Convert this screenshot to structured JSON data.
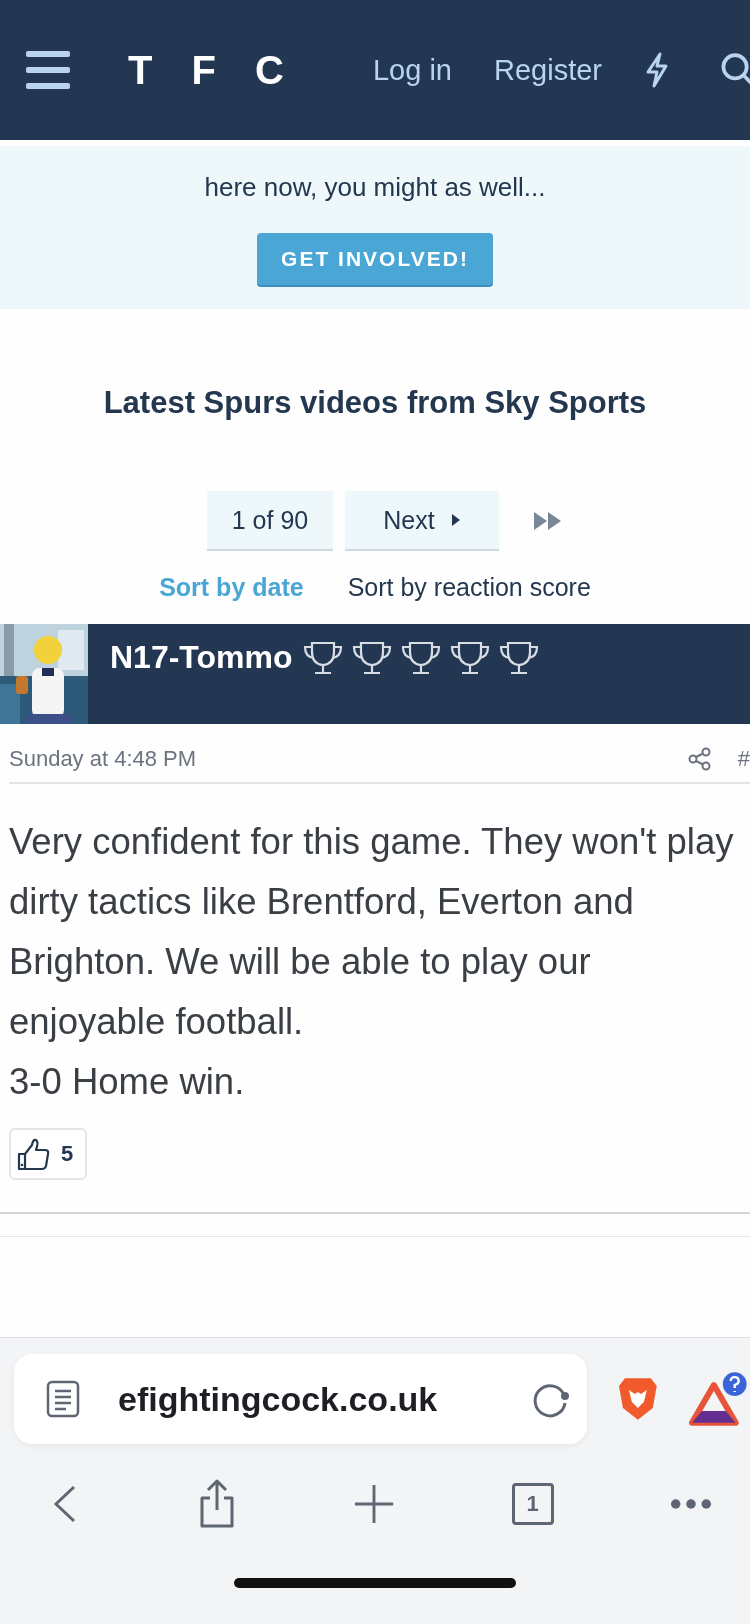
{
  "header": {
    "logo": "T F C",
    "nav": [
      {
        "label": "Log in"
      },
      {
        "label": "Register"
      }
    ]
  },
  "banner": {
    "text": "here now, you might as well...",
    "button": "GET INVOLVED!"
  },
  "section_title": "Latest Spurs videos from Sky Sports",
  "pagination": {
    "page": "1 of 90",
    "next": "Next"
  },
  "sort_options": [
    {
      "label": "Sort by date",
      "selected": true
    },
    {
      "label": "Sort by reaction score",
      "selected": false
    }
  ],
  "post": {
    "author": "N17-Tommo",
    "trophies": [
      {
        "kind": "trophy"
      },
      {
        "kind": "trophy"
      },
      {
        "kind": "trophy"
      },
      {
        "kind": "trophy"
      },
      {
        "kind": "trophy"
      }
    ],
    "date": "Sunday at 4:48 PM",
    "number": "#",
    "body": [
      "Very confident for this game. They won't play dirty tactics like Brentford, Everton and Brighton. We will be able to play our enjoyable football.",
      "3-0 Home win."
    ],
    "likes": "5"
  },
  "browser": {
    "url": "efightingcock.co.uk",
    "tab_count": "1"
  }
}
